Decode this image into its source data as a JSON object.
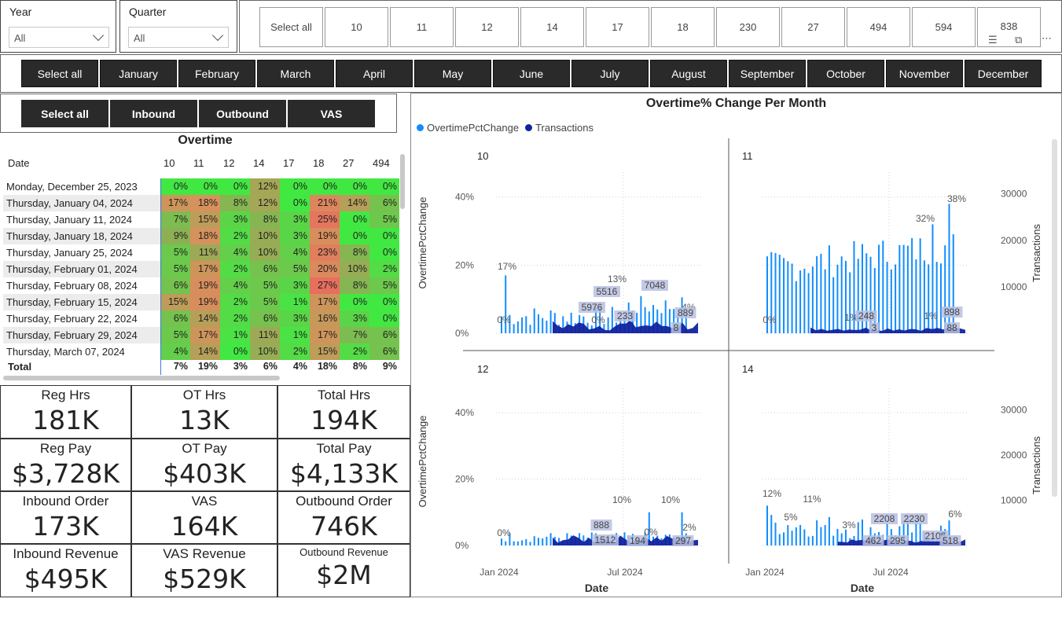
{
  "year_slicer": {
    "title": "Year",
    "value": "All"
  },
  "quarter_slicer": {
    "title": "Quarter",
    "value": "All"
  },
  "tiles": [
    "Select all",
    "10",
    "11",
    "12",
    "14",
    "17",
    "18",
    "230",
    "27",
    "494",
    "594",
    "838"
  ],
  "months": [
    "Select all",
    "January",
    "February",
    "March",
    "April",
    "May",
    "June",
    "July",
    "August",
    "September",
    "October",
    "November",
    "December"
  ],
  "types": [
    "Select all",
    "Inbound",
    "Outbound",
    "VAS"
  ],
  "matrix": {
    "title": "Overtime",
    "date_header": "Date",
    "columns": [
      "10",
      "11",
      "12",
      "14",
      "17",
      "18",
      "27",
      "494"
    ],
    "rows": [
      {
        "date": "Monday, December 25, 2023",
        "values": [
          "0%",
          "0%",
          "0%",
          "12%",
          "0%",
          "0%",
          "0%",
          "0%"
        ]
      },
      {
        "date": "Thursday, January 04, 2024",
        "values": [
          "17%",
          "18%",
          "8%",
          "12%",
          "0%",
          "21%",
          "14%",
          "6%"
        ]
      },
      {
        "date": "Thursday, January 11, 2024",
        "values": [
          "7%",
          "15%",
          "3%",
          "8%",
          "3%",
          "25%",
          "0%",
          "5%"
        ]
      },
      {
        "date": "Thursday, January 18, 2024",
        "values": [
          "9%",
          "18%",
          "2%",
          "10%",
          "3%",
          "19%",
          "0%",
          "0%"
        ]
      },
      {
        "date": "Thursday, January 25, 2024",
        "values": [
          "5%",
          "11%",
          "4%",
          "10%",
          "4%",
          "23%",
          "8%",
          "0%"
        ]
      },
      {
        "date": "Thursday, February 01, 2024",
        "values": [
          "5%",
          "17%",
          "2%",
          "6%",
          "5%",
          "20%",
          "10%",
          "2%"
        ]
      },
      {
        "date": "Thursday, February 08, 2024",
        "values": [
          "6%",
          "19%",
          "4%",
          "5%",
          "3%",
          "27%",
          "8%",
          "5%"
        ]
      },
      {
        "date": "Thursday, February 15, 2024",
        "values": [
          "15%",
          "19%",
          "2%",
          "5%",
          "1%",
          "17%",
          "0%",
          "0%"
        ]
      },
      {
        "date": "Thursday, February 22, 2024",
        "values": [
          "6%",
          "14%",
          "2%",
          "6%",
          "3%",
          "16%",
          "3%",
          "0%"
        ]
      },
      {
        "date": "Thursday, February 29, 2024",
        "values": [
          "5%",
          "17%",
          "1%",
          "11%",
          "1%",
          "17%",
          "7%",
          "6%"
        ]
      },
      {
        "date": "Thursday, March 07, 2024",
        "values": [
          "4%",
          "14%",
          "0%",
          "10%",
          "2%",
          "15%",
          "2%",
          "6%"
        ]
      }
    ],
    "total_label": "Total",
    "totals": [
      "7%",
      "19%",
      "3%",
      "6%",
      "4%",
      "18%",
      "8%",
      "9%"
    ]
  },
  "kpis": [
    {
      "label": "Reg Hrs",
      "value": "181K"
    },
    {
      "label": "OT Hrs",
      "value": "13K"
    },
    {
      "label": "Total Hrs",
      "value": "194K"
    },
    {
      "label": "Reg Pay",
      "value": "$3,728K"
    },
    {
      "label": "OT Pay",
      "value": "$403K"
    },
    {
      "label": "Total Pay",
      "value": "$4,133K"
    },
    {
      "label": "Inbound Order",
      "value": "173K"
    },
    {
      "label": "VAS",
      "value": "164K"
    },
    {
      "label": "Outbound Order",
      "value": "746K"
    },
    {
      "label": "Inbound Revenue",
      "value": "$495K"
    },
    {
      "label": "VAS Revenue",
      "value": "$529K"
    },
    {
      "label": "Outbound Revenue",
      "value": "$2M"
    }
  ],
  "chart": {
    "title": "Overtime% Change Per Month",
    "legend": [
      "OvertimePctChange",
      "Transactions"
    ],
    "colors": {
      "pct": "#118DFF",
      "trans": "#12239E",
      "label_bg": "#b8bfe0"
    },
    "left_axis_title": "OvertimePctChange",
    "right_axis_title": "Transactions",
    "x_axis_title": "Date",
    "x_ticks": [
      "Jan 2024",
      "Jul 2024"
    ],
    "left_ticks": [
      "40%",
      "20%",
      "0%"
    ],
    "right_ticks": [
      "30000",
      "20000",
      "10000"
    ]
  },
  "chart_data": [
    {
      "type": "bar",
      "panel": "10",
      "series": [
        {
          "name": "OvertimePctChange",
          "data_labels": [
            "17%",
            "0%",
            "0%",
            "13%",
            "4%"
          ]
        },
        {
          "name": "Transactions",
          "data_labels": [
            "5976",
            "5516",
            "233",
            "7048",
            "889",
            "8"
          ]
        }
      ],
      "ylim_left": [
        0,
        0.45
      ],
      "ylim_right": [
        0,
        33000
      ]
    },
    {
      "type": "bar",
      "panel": "11",
      "series": [
        {
          "name": "OvertimePctChange",
          "data_labels": [
            "0%",
            "1%",
            "1%",
            "32%",
            "38%"
          ]
        },
        {
          "name": "Transactions",
          "data_labels": [
            "248",
            "3",
            "898",
            "88"
          ]
        }
      ],
      "ylim_left": [
        0,
        0.45
      ],
      "ylim_right": [
        0,
        33000
      ]
    },
    {
      "type": "bar",
      "panel": "12",
      "series": [
        {
          "name": "OvertimePctChange",
          "data_labels": [
            "0%",
            "10%",
            "0%",
            "10%",
            "2%"
          ]
        },
        {
          "name": "Transactions",
          "data_labels": [
            "888",
            "1512",
            "194",
            "297"
          ]
        }
      ],
      "ylim_left": [
        0,
        0.45
      ],
      "ylim_right": [
        0,
        33000
      ]
    },
    {
      "type": "bar",
      "panel": "14",
      "series": [
        {
          "name": "OvertimePctChange",
          "data_labels": [
            "12%",
            "5%",
            "11%",
            "3%",
            "6%"
          ]
        },
        {
          "name": "Transactions",
          "data_labels": [
            "2208",
            "462",
            "295",
            "2230",
            "2106",
            "518"
          ]
        }
      ],
      "ylim_left": [
        0,
        0.45
      ],
      "ylim_right": [
        0,
        33000
      ]
    }
  ]
}
